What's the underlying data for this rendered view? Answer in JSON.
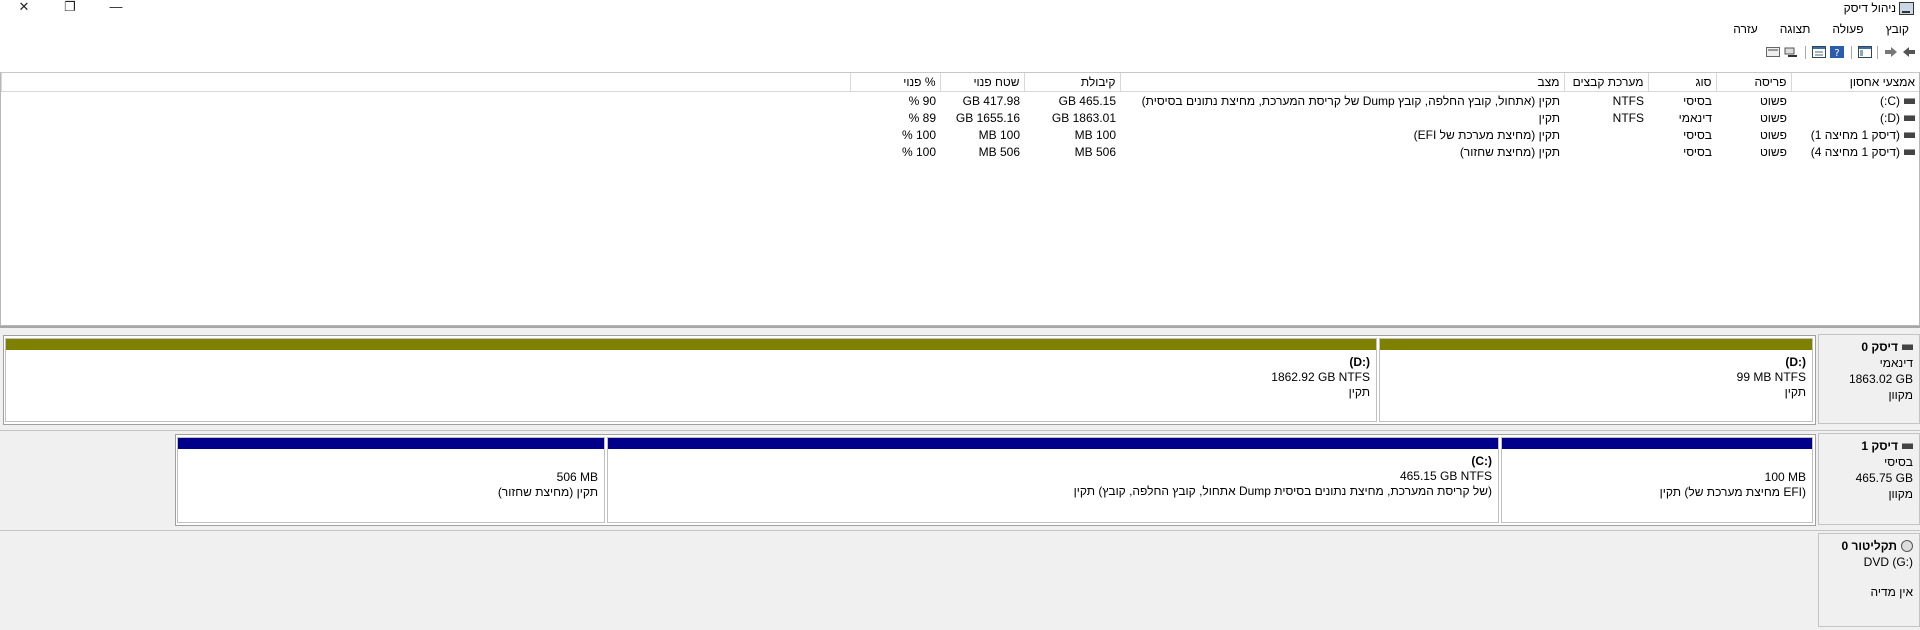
{
  "window": {
    "title": "ניהול דיסק",
    "controls": [
      "close-icon",
      "restore-icon",
      "minimize-icon"
    ]
  },
  "menu": [
    "קובץ",
    "פעולה",
    "תצוגה",
    "עזרה"
  ],
  "toolbar": [
    "back-icon",
    "forward-icon",
    "console-tree-icon",
    "help-icon",
    "properties-icon",
    "rescan-icon",
    "view-icon"
  ],
  "columns": [
    "אמצעי אחסון",
    "פריסה",
    "סוג",
    "מערכת קבצים",
    "מצב",
    "קיבולת",
    "שטח פנוי",
    "% פנוי"
  ],
  "volumes": [
    {
      "name": "(C:)",
      "layout": "פשוט",
      "type": "בסיסי",
      "fs": "NTFS",
      "status": "תקין (אתחול, קובץ החלפה, קובץ Dump של קריסת המערכת, מחיצת נתונים בסיסית)",
      "capacity": "465.15 GB",
      "free": "417.98 GB",
      "pct": "90 %"
    },
    {
      "name": "(D:)",
      "layout": "פשוט",
      "type": "דינאמי",
      "fs": "NTFS",
      "status": "תקין",
      "capacity": "1863.01 GB",
      "free": "1655.16 GB",
      "pct": "89 %"
    },
    {
      "name": "(דיסק 1 מחיצה 1)",
      "layout": "פשוט",
      "type": "בסיסי",
      "fs": "",
      "status": "תקין (מחיצת מערכת של EFI)",
      "capacity": "100 MB",
      "free": "100 MB",
      "pct": "100 %"
    },
    {
      "name": "(דיסק 1 מחיצה 4)",
      "layout": "פשוט",
      "type": "בסיסי",
      "fs": "",
      "status": "תקין (מחיצת שחזור)",
      "capacity": "506 MB",
      "free": "506 MB",
      "pct": "100 %"
    }
  ],
  "disks": [
    {
      "name": "דיסק 0",
      "type": "דינאמי",
      "size": "1863.02 GB",
      "status": "מקוון",
      "partitions": [
        {
          "label": "(D:)",
          "size": "99 MB NTFS",
          "status": "תקין"
        },
        {
          "label": "(D:)",
          "size": "1862.92 GB NTFS",
          "status": "תקין"
        }
      ]
    },
    {
      "name": "דיסק 1",
      "type": "בסיסי",
      "size": "465.75 GB",
      "status": "מקוון",
      "partitions": [
        {
          "label": "",
          "size": "100 MB",
          "status": "תקין (מחיצת מערכת של EFI)"
        },
        {
          "label": "(C:)",
          "size": "465.15 GB NTFS",
          "status": "תקין (אתחול, קובץ החלפה, קובץ Dump של קריסת המערכת, מחיצת נתונים בסיסית)"
        },
        {
          "label": "",
          "size": "506 MB",
          "status": "תקין (מחיצת שחזור)"
        }
      ]
    },
    {
      "name": "תקליטור 0",
      "type": "DVD (G:)",
      "status": "אין מדיה"
    }
  ],
  "colors": {
    "dynamic_bar": "#808000",
    "basic_bar": "#00008b"
  }
}
